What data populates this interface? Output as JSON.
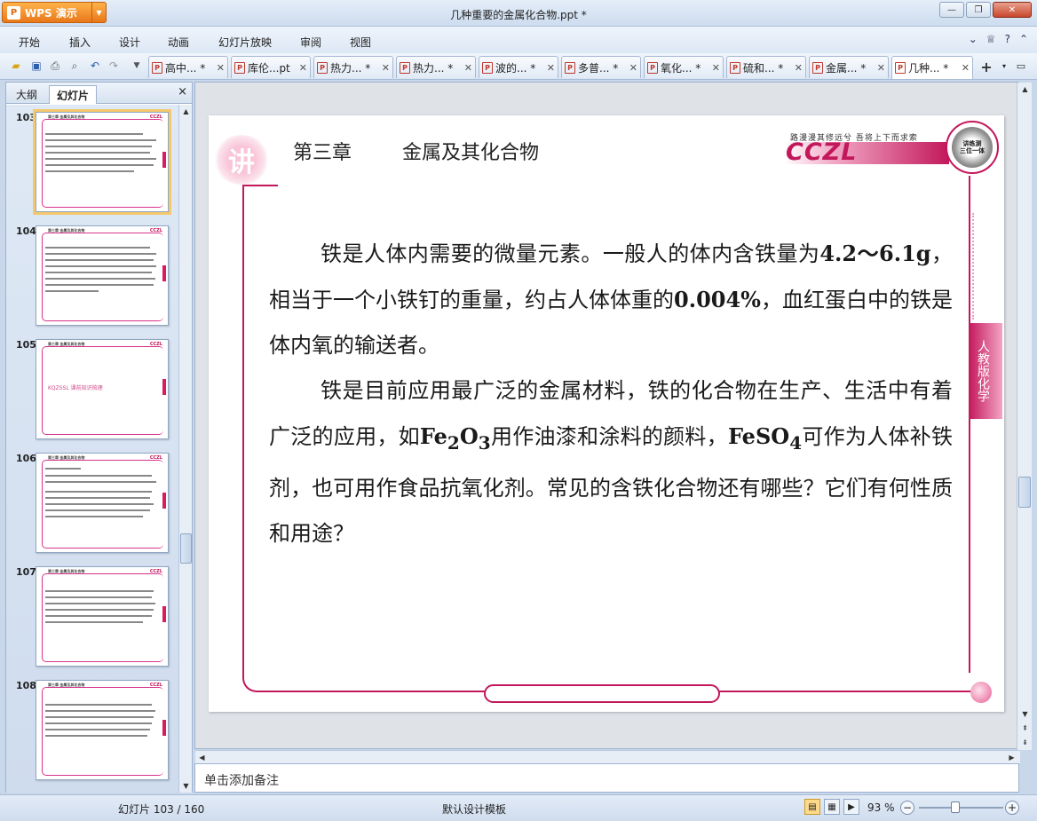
{
  "app": {
    "logo": "WPS 演示",
    "window_title": "几种重要的金属化合物.ppt *"
  },
  "menu": {
    "items": [
      "开始",
      "插入",
      "设计",
      "动画",
      "幻灯片放映",
      "审阅",
      "视图"
    ],
    "help_icon": "?"
  },
  "tabs": [
    {
      "label": "高中... *"
    },
    {
      "label": "库伦...pt"
    },
    {
      "label": "热力... *"
    },
    {
      "label": "热力... *"
    },
    {
      "label": "波的... *"
    },
    {
      "label": "多普... *"
    },
    {
      "label": "氧化... *"
    },
    {
      "label": "硫和... *"
    },
    {
      "label": "金属... *"
    },
    {
      "label": "几种... *"
    }
  ],
  "left_panel": {
    "tab_outline": "大纲",
    "tab_slides": "幻灯片",
    "close": "×"
  },
  "thumbnails": [
    {
      "num": "103",
      "selected": true
    },
    {
      "num": "104"
    },
    {
      "num": "105",
      "text": "KQZSSL 课前知识梳理"
    },
    {
      "num": "106"
    },
    {
      "num": "107"
    },
    {
      "num": "108"
    }
  ],
  "slide": {
    "chapter": "第三章",
    "topic": "金属及其化合物",
    "motto": "路漫漫其修远兮 吾将上下而求索",
    "logo": "CCZL",
    "badge_line1": "讲练测",
    "badge_line2": "三位一体",
    "seal": "讲",
    "side_tag": "人教版化学",
    "para1_a": "铁是人体内需要的微量元素。一般人的体内含铁量为",
    "para1_b": "4.2～6.1g",
    "para1_c": "，相当于一个小铁钉的重量，约占人体体重的",
    "para1_d": "0.004%",
    "para1_e": "，血红蛋白中的铁是体内氧的输送者。",
    "para2_a": "铁是目前应用最广泛的金属材料，铁的化合物在生产、生活中有着广泛的应用，如",
    "fe2o3_fe": "Fe",
    "fe2o3_2": "2",
    "fe2o3_o": "O",
    "fe2o3_3": "3",
    "para2_b": "用作油漆和涂料的颜料，",
    "feso4_a": "FeSO",
    "feso4_4": "4",
    "para2_c": "可作为人体补铁剂，也可用作食品抗氧化剂。常见的含铁化合物还有哪些？它们有何性质和用途？"
  },
  "notes": {
    "placeholder": "单击添加备注"
  },
  "status": {
    "slide": "幻灯片 103 / 160",
    "template": "默认设计模板",
    "zoom": "93 %"
  }
}
